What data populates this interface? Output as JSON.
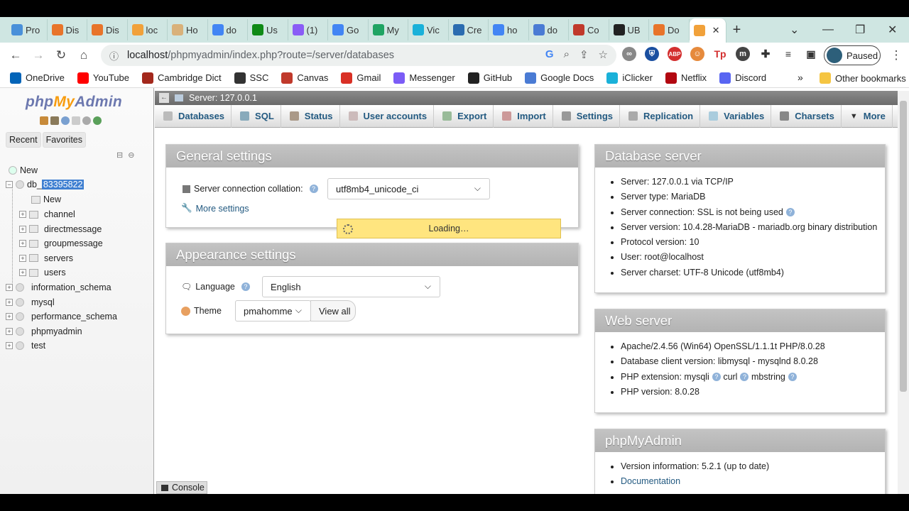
{
  "browser": {
    "tabs": [
      {
        "label": "Pro",
        "color": "#4a90d9"
      },
      {
        "label": "Dis",
        "color": "#e8742a"
      },
      {
        "label": "Dis",
        "color": "#e8742a"
      },
      {
        "label": "loc",
        "color": "#f1a13a"
      },
      {
        "label": "Ho",
        "color": "#d9b17a"
      },
      {
        "label": "do",
        "color": "#4285f4"
      },
      {
        "label": "Us",
        "color": "#0f8a16"
      },
      {
        "label": "(1)",
        "color": "#8a5cf6"
      },
      {
        "label": "Go",
        "color": "#4285f4"
      },
      {
        "label": "My",
        "color": "#1fa463"
      },
      {
        "label": "Vic",
        "color": "#1ab1d9"
      },
      {
        "label": "Cre",
        "color": "#2b6cb0"
      },
      {
        "label": "ho",
        "color": "#4285f4"
      },
      {
        "label": "do",
        "color": "#4a7bd4"
      },
      {
        "label": "Co",
        "color": "#c0392b"
      },
      {
        "label": "UB",
        "color": "#222222"
      },
      {
        "label": "Do",
        "color": "#e8742a"
      }
    ],
    "active_tab_close": "✕",
    "new_tab": "+",
    "url_host": "localhost",
    "url_path": "/phpmyadmin/index.php?route=/server/databases",
    "profile_status": "Paused",
    "bookmarks": [
      {
        "label": "OneDrive",
        "color": "#0364b8"
      },
      {
        "label": "YouTube",
        "color": "#ff0000"
      },
      {
        "label": "Cambridge Dict",
        "color": "#a3281c"
      },
      {
        "label": "SSC",
        "color": "#333333"
      },
      {
        "label": "Canvas",
        "color": "#c0392b"
      },
      {
        "label": "Gmail",
        "color": "#d93025"
      },
      {
        "label": "Messenger",
        "color": "#7b5cf6"
      },
      {
        "label": "GitHub",
        "color": "#222222"
      },
      {
        "label": "Google Docs",
        "color": "#4a7bd4"
      },
      {
        "label": "iClicker",
        "color": "#1ab1d9"
      },
      {
        "label": "Netflix",
        "color": "#b20710"
      },
      {
        "label": "Discord",
        "color": "#5865f2"
      }
    ],
    "bookmarks_more": "»",
    "other_bookmarks": "Other bookmarks"
  },
  "pma": {
    "logo_php": "php",
    "logo_my": "My",
    "logo_admin": "Admin",
    "nav_tabs": [
      "Recent",
      "Favorites"
    ],
    "tree": {
      "new_root": "New",
      "db_prefix": "db_",
      "db_selected": "83395822",
      "db_new": "New",
      "tables": [
        "channel",
        "directmessage",
        "groupmessage",
        "servers",
        "users"
      ],
      "databases": [
        "information_schema",
        "mysql",
        "performance_schema",
        "phpmyadmin",
        "test"
      ]
    },
    "server_label": "Server: 127.0.0.1",
    "menu": [
      "Databases",
      "SQL",
      "Status",
      "User accounts",
      "Export",
      "Import",
      "Settings",
      "Replication",
      "Variables",
      "Charsets",
      "More"
    ],
    "general": {
      "title": "General settings",
      "collation_label": "Server connection collation:",
      "collation_value": "utf8mb4_unicode_ci",
      "more_settings": "More settings"
    },
    "loading": "Loading…",
    "appearance": {
      "title": "Appearance settings",
      "language_label": "Language",
      "language_value": "English",
      "theme_label": "Theme",
      "theme_value": "pmahomme",
      "view_all": "View all"
    },
    "db_server": {
      "title": "Database server",
      "items": [
        "Server: 127.0.0.1 via TCP/IP",
        "Server type: MariaDB",
        "Server connection: SSL is not being used",
        "Server version: 10.4.28-MariaDB - mariadb.org binary distribution",
        "Protocol version: 10",
        "User: root@localhost",
        "Server charset: UTF-8 Unicode (utf8mb4)"
      ]
    },
    "web_server": {
      "title": "Web server",
      "items": [
        "Apache/2.4.56 (Win64) OpenSSL/1.1.1t PHP/8.0.28",
        "Database client version: libmysql - mysqlnd 8.0.28",
        "PHP extension: mysqli",
        "curl",
        "mbstring",
        "PHP version: 8.0.28"
      ]
    },
    "pma_panel": {
      "title": "phpMyAdmin",
      "version": "Version information: 5.2.1 (up to date)",
      "documentation": "Documentation"
    },
    "console": "Console"
  }
}
